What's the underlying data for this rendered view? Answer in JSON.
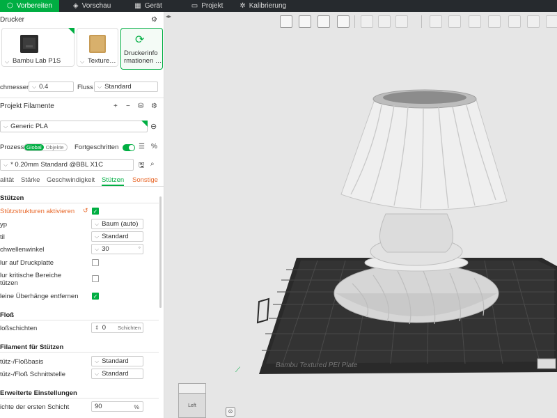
{
  "tabs": [
    {
      "label": "Vorbereiten",
      "icon": "cube-icon",
      "active": true
    },
    {
      "label": "Vorschau",
      "icon": "layers-icon",
      "active": false
    },
    {
      "label": "Gerät",
      "icon": "device-icon",
      "active": false
    },
    {
      "label": "Projekt",
      "icon": "project-icon",
      "active": false
    },
    {
      "label": "Kalibrierung",
      "icon": "calibration-icon",
      "active": false
    }
  ],
  "printer": {
    "section_title": "Drucker",
    "printer_name": "Bambu Lab P1S",
    "plate_name": "Texture…",
    "info_label_line1": "Druckerinfo",
    "info_label_line2": "rmationen …",
    "nozzle_label": "chmesser",
    "nozzle_value": "0.4",
    "flow_label": "Fluss",
    "flow_value": "Standard"
  },
  "filament": {
    "section_title": "Projekt Filamente",
    "item": "Generic PLA"
  },
  "process": {
    "section_title": "Prozess",
    "seg_global": "Global",
    "seg_objects": "Objekte",
    "advanced_label": "Fortgeschritten",
    "preset": "* 0.20mm Standard @BBL X1C"
  },
  "subtabs": [
    {
      "label": "alität"
    },
    {
      "label": "Stärke"
    },
    {
      "label": "Geschwindigkeit"
    },
    {
      "label": "Stützen"
    },
    {
      "label": "Sonstige"
    }
  ],
  "supports": {
    "group_title": "Stützen",
    "enable_label": "Stützstrukturen aktivieren",
    "type_label": "yp",
    "type_value": "Baum (auto)",
    "style_label": "til",
    "style_value": "Standard",
    "threshold_label": "chwellenwinkel",
    "threshold_value": "30",
    "threshold_unit": "°",
    "plate_only_label": "lur auf Druckplatte",
    "critical_label_1": "lur kritische Bereiche",
    "critical_label_2": "tützen",
    "remove_small_label": "leine Überhänge entfernen"
  },
  "raft": {
    "group_title": "Floß",
    "layers_label": "loßschichten",
    "layers_value": "0",
    "layers_unit": "Schichten"
  },
  "support_filament": {
    "group_title": "Filament für Stützen",
    "base_label": "tütz-/Floßbasis",
    "base_value": "Standard",
    "interface_label": "tütz-/Floß Schnittstelle",
    "interface_value": "Standard"
  },
  "advanced": {
    "group_title": "Erweiterte Einstellungen",
    "density_label": "ichte der ersten Schicht",
    "density_value": "90",
    "density_unit": "%"
  },
  "viewport": {
    "plate_label": "Bambu Textured PEI Plate",
    "view_label": "Left"
  },
  "colors": {
    "accent": "#00ae42",
    "topbar": "#262a2e",
    "warn": "#e8682a"
  }
}
